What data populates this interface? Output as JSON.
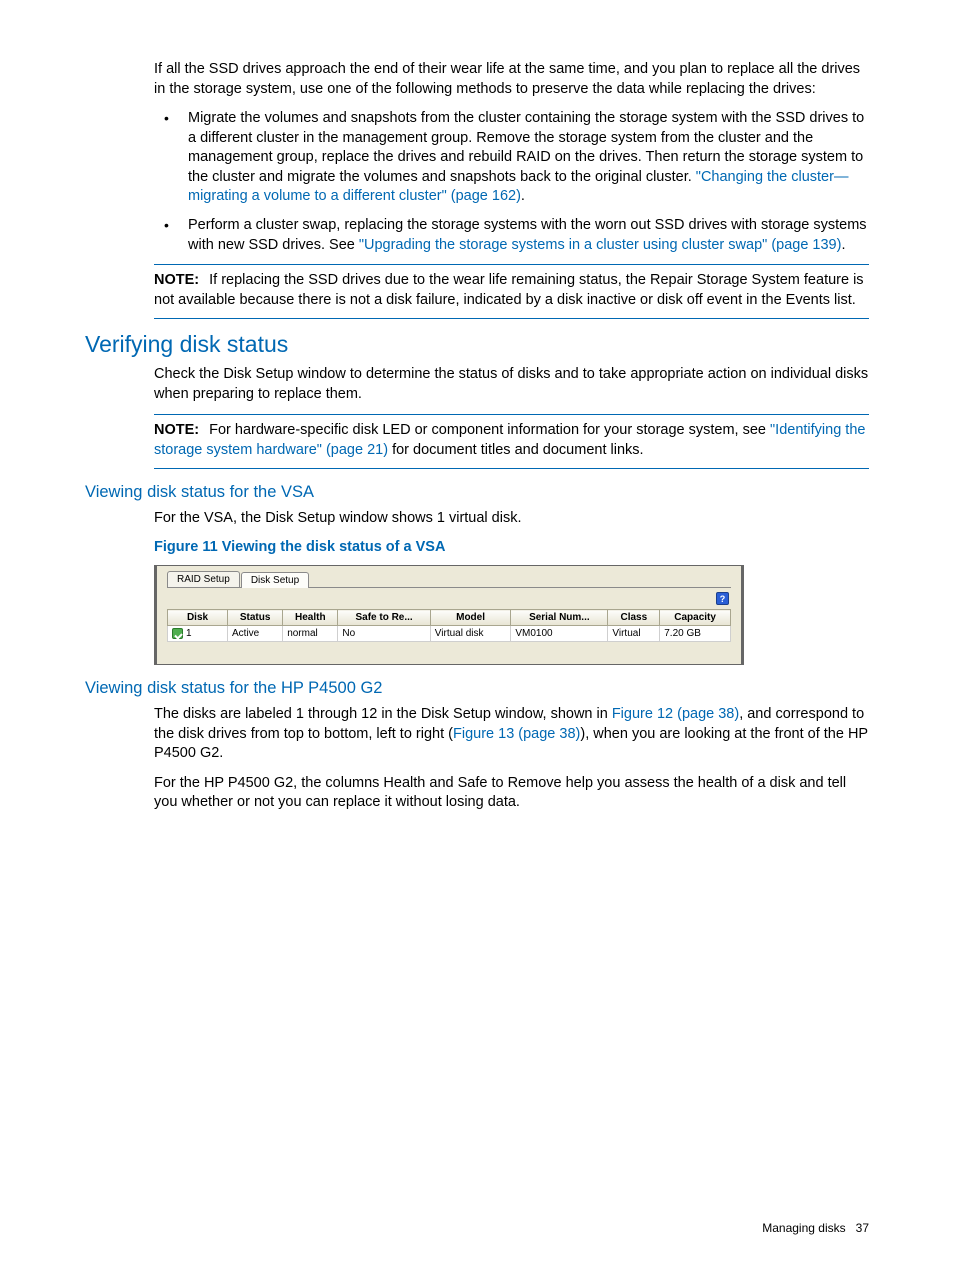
{
  "intro": "If all the SSD drives approach the end of their wear life at the same time, and you plan to replace all the drives in the storage system, use one of the following methods to preserve the data while replacing the drives:",
  "bullets": [
    {
      "text": "Migrate the volumes and snapshots from the cluster containing the storage system with the SSD drives to a different cluster in the management group. Remove the storage system from the cluster and the management group, replace the drives and rebuild RAID on the drives. Then return the storage system to the cluster and migrate the volumes and snapshots back to the original cluster. ",
      "link": "\"Changing the cluster—migrating a volume to a different cluster\" (page 162)",
      "after": "."
    },
    {
      "text": "Perform a cluster swap, replacing the storage systems with the worn out SSD drives with storage systems with new SSD drives. See ",
      "link": "\"Upgrading the storage systems in a cluster using cluster swap\" (page 139)",
      "after": "."
    }
  ],
  "note1": {
    "label": "NOTE:",
    "text": "If replacing the SSD drives due to the wear life remaining status, the Repair Storage System feature is not available because there is not a disk failure, indicated by a disk inactive or disk off event in the Events list."
  },
  "h2_verifying": "Verifying disk status",
  "verifying_para": "Check the Disk Setup window to determine the status of disks and to take appropriate action on individual disks when preparing to replace them.",
  "note2": {
    "label": "NOTE:",
    "pre": "For hardware-specific disk LED or component information for your storage system, see ",
    "link": "\"Identifying the storage system hardware\" (page 21)",
    "post": " for document titles and document links."
  },
  "h3_vsa": "Viewing disk status for the VSA",
  "vsa_para": "For the VSA, the Disk Setup window shows 1 virtual disk.",
  "fig11_caption": "Figure 11 Viewing the disk status of a VSA",
  "fig11": {
    "tabs": {
      "raid": "RAID Setup",
      "disk": "Disk Setup"
    },
    "help": "?",
    "headers": {
      "disk": "Disk",
      "status": "Status",
      "health": "Health",
      "safe": "Safe to Re...",
      "model": "Model",
      "serial": "Serial Num...",
      "class": "Class",
      "capacity": "Capacity"
    },
    "row": {
      "disk": "1",
      "status": "Active",
      "health": "normal",
      "safe": "No",
      "model": "Virtual disk",
      "serial": "VM0100",
      "class": "Virtual",
      "capacity": "7.20 GB"
    }
  },
  "h3_p4500": "Viewing disk status for the HP P4500 G2",
  "p4500_para1": {
    "pre": "The disks are labeled 1 through 12 in the Disk Setup window, shown in ",
    "link1": "Figure 12 (page 38)",
    "mid": ", and correspond to the disk drives from top to bottom, left to right (",
    "link2": "Figure 13 (page 38)",
    "post": "), when you are looking at the front of the HP P4500 G2."
  },
  "p4500_para2": "For the HP P4500 G2, the columns Health and Safe to Remove help you assess the health of a disk and tell you whether or not you can replace it without losing data.",
  "footer": {
    "section": "Managing disks",
    "page": "37"
  }
}
